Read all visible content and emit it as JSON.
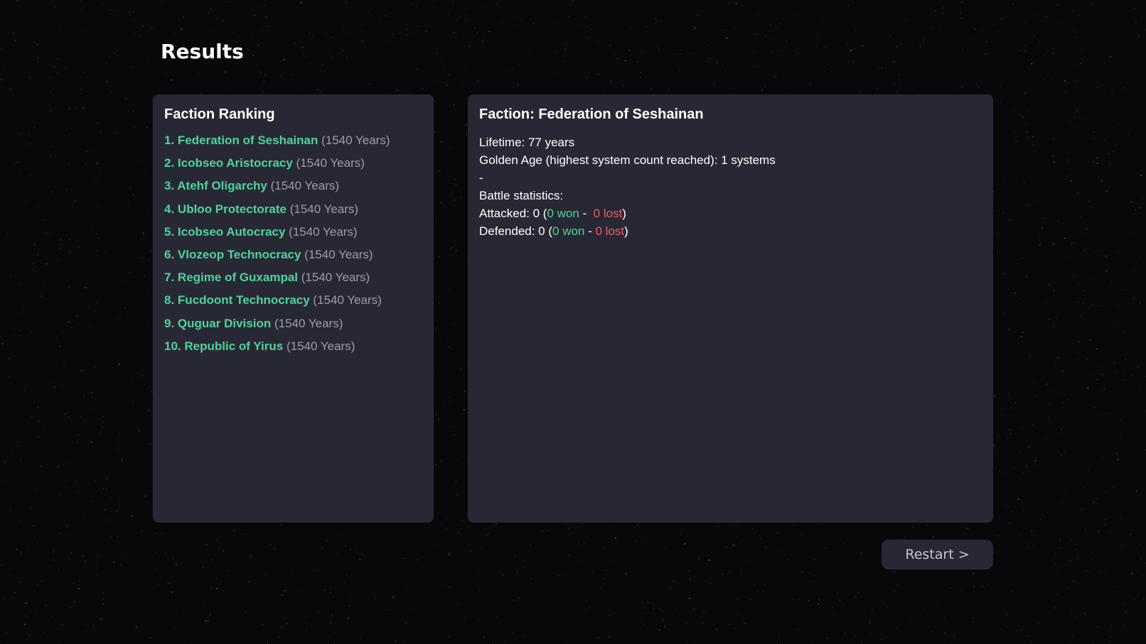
{
  "title": "Results",
  "ranking": {
    "title": "Faction Ranking",
    "items": [
      {
        "rank": "1.",
        "name": "Federation of Seshainan",
        "years": "(1540 Years)"
      },
      {
        "rank": "2.",
        "name": "Icobseo Aristocracy",
        "years": "(1540 Years)"
      },
      {
        "rank": "3.",
        "name": "Atehf Oligarchy",
        "years": "(1540 Years)"
      },
      {
        "rank": "4.",
        "name": "Ubloo Protectorate",
        "years": "(1540 Years)"
      },
      {
        "rank": "5.",
        "name": "Icobseo Autocracy",
        "years": "(1540 Years)"
      },
      {
        "rank": "6.",
        "name": "Vlozeop Technocracy",
        "years": "(1540 Years)"
      },
      {
        "rank": "7.",
        "name": "Regime of Guxampal",
        "years": "(1540 Years)"
      },
      {
        "rank": "8.",
        "name": "Fucdoont Technocracy",
        "years": "(1540 Years)"
      },
      {
        "rank": "9.",
        "name": "Quguar Division",
        "years": "(1540 Years)"
      },
      {
        "rank": "10.",
        "name": "Republic of Yirus",
        "years": "(1540 Years)"
      }
    ]
  },
  "detail": {
    "title": "Faction: Federation of Seshainan",
    "lifetime": "Lifetime: 77 years",
    "golden_age": "Golden Age (highest system count reached): 1 systems",
    "separator": "-",
    "battle_heading": "Battle statistics:",
    "attacked": {
      "label": "Attacked: 0 (",
      "won": "0 won",
      "sep": " -  ",
      "lost": "0 lost",
      "close": ")"
    },
    "defended": {
      "label": "Defended: 0 (",
      "won": "0 won",
      "sep": " - ",
      "lost": "0 lost",
      "close": ")"
    }
  },
  "restart_label": "Restart >",
  "colors": {
    "background": "#08080b",
    "panel": "#282835",
    "faction_name": "#4fd39a",
    "years": "#9c9caa",
    "won": "#4fd39a",
    "lost": "#f05b67"
  }
}
